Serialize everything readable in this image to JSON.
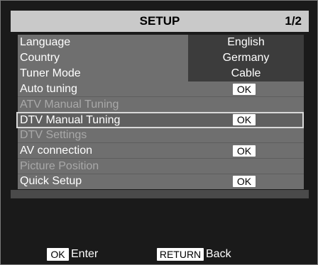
{
  "header": {
    "title": "SETUP",
    "page": "1/2"
  },
  "menu": {
    "items": [
      {
        "label": "Language",
        "value": "English"
      },
      {
        "label": "Country",
        "value": "Germany"
      },
      {
        "label": "Tuner Mode",
        "value": "Cable"
      },
      {
        "label": "Auto tuning",
        "button": "OK"
      },
      {
        "label": "ATV Manual Tuning",
        "disabled": true
      },
      {
        "label": "DTV Manual Tuning",
        "button": "OK",
        "selected": true
      },
      {
        "label": "DTV Settings",
        "disabled": true
      },
      {
        "label": "AV connection",
        "button": "OK"
      },
      {
        "label": "Picture Position",
        "disabled": true
      },
      {
        "label": "Quick Setup",
        "button": "OK"
      }
    ]
  },
  "footer": {
    "ok_key": "OK",
    "enter_label": "Enter",
    "return_key": "RETURN",
    "back_label": "Back"
  },
  "colors": {
    "header_bg": "#c9c9c9",
    "menu_bg": "#6f6f6f",
    "value_bg": "#3c3c3c",
    "disabled_text": "#a9a9a9",
    "selection_border": "#d9d9d9"
  }
}
